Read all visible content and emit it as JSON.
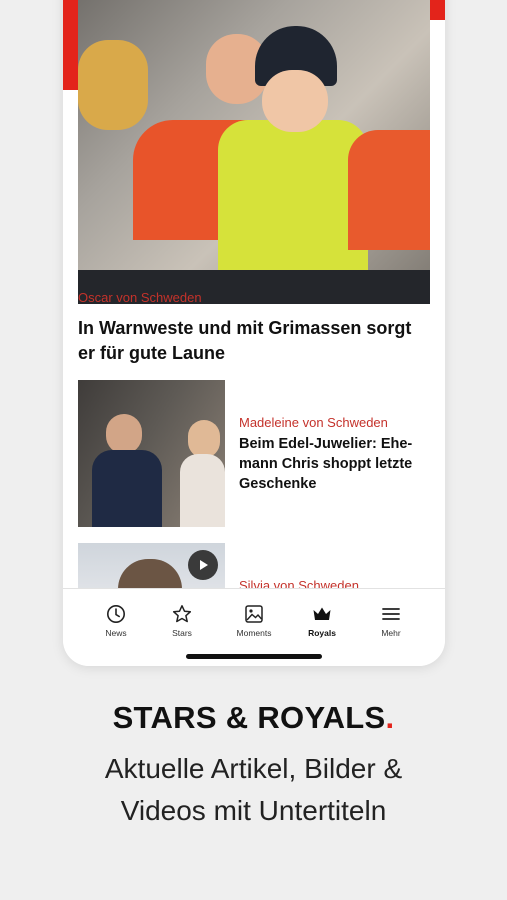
{
  "hero": {
    "kicker": "Oscar von Schweden",
    "headline": "In Warnweste und mit Grimassen sorgt er für gute Laune"
  },
  "articles": [
    {
      "kicker": "Madeleine von Schweden",
      "title": "Beim Edel-Juwelier: Ehe-mann Chris shoppt letzte Geschenke",
      "has_video": false
    },
    {
      "kicker": "Silvia von Schweden",
      "title": "",
      "has_video": true
    }
  ],
  "tabbar": {
    "items": [
      {
        "label": "News",
        "icon": "clock-icon",
        "active": false
      },
      {
        "label": "Stars",
        "icon": "star-icon",
        "active": false
      },
      {
        "label": "Moments",
        "icon": "image-icon",
        "active": false
      },
      {
        "label": "Royals",
        "icon": "crown-icon",
        "active": true
      },
      {
        "label": "Mehr",
        "icon": "menu-icon",
        "active": false
      }
    ]
  },
  "promo": {
    "title": "STARS & ROYALS",
    "title_dot": ".",
    "subtitle_line1": "Aktuelle Artikel, Bilder &",
    "subtitle_line2": "Videos mit Untertiteln"
  },
  "colors": {
    "accent": "#e3241b",
    "kicker": "#c4322b"
  }
}
